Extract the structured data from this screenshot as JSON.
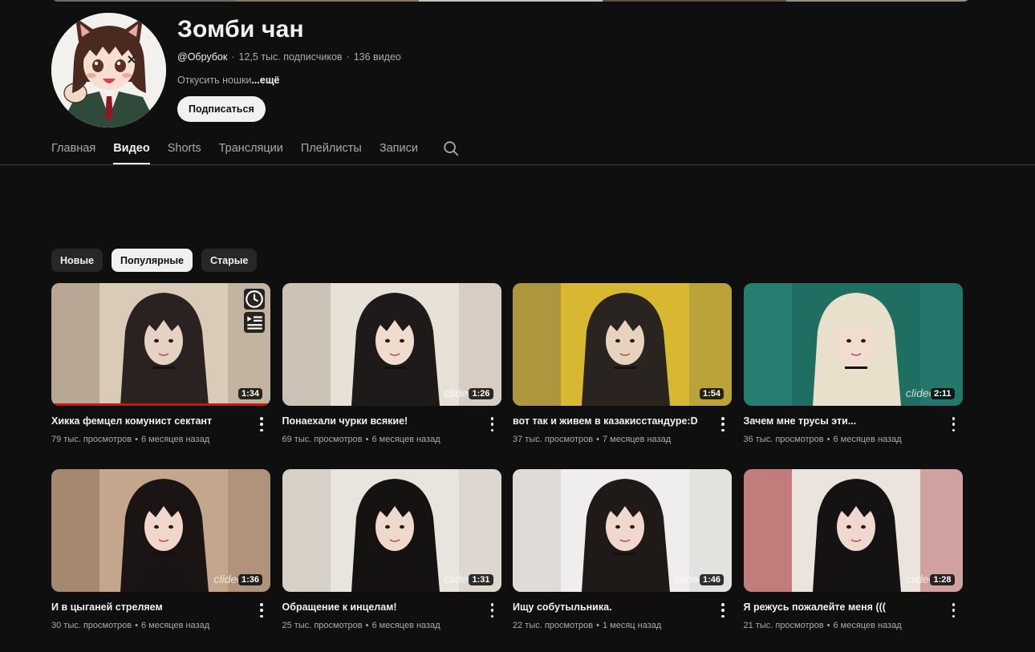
{
  "channel": {
    "name": "Зомби чан",
    "handle": "@Обрубок",
    "subscribers": "12,5 тыс. подписчиков",
    "video_count": "136 видео",
    "separator": "·",
    "description": "Откусить ношки",
    "more_label": "...ещё",
    "subscribe_label": "Подписаться"
  },
  "tabs": [
    {
      "label": "Главная",
      "active": false
    },
    {
      "label": "Видео",
      "active": true
    },
    {
      "label": "Shorts",
      "active": false
    },
    {
      "label": "Трансляции",
      "active": false
    },
    {
      "label": "Плейлисты",
      "active": false
    },
    {
      "label": "Записи",
      "active": false
    }
  ],
  "search_icon": "search-icon",
  "sort_chips": [
    {
      "label": "Новые",
      "selected": false
    },
    {
      "label": "Популярные",
      "selected": true
    },
    {
      "label": "Старые",
      "selected": false
    }
  ],
  "watermark_text": "clideo",
  "meta_separator": "•",
  "colors": {
    "background": "#0f0f0f",
    "progress": "#ff0000",
    "chip": "#272727",
    "chip_selected": "#f1f1f1"
  },
  "videos": [
    {
      "title": "Хикка фемцел комунист сектант",
      "views": "79 тыс. просмотров",
      "age": "6 месяцев назад",
      "duration": "1:34",
      "watermark": false,
      "watch_progress": 1.0,
      "hover_icons": [
        "clock-icon",
        "queue-icon"
      ],
      "palette": [
        "#d9cbb8",
        "#9c8a78",
        "#2a2220",
        "#e6d2c2"
      ]
    },
    {
      "title": "Понаехали чурки всякие!",
      "views": "69 тыс. просмотров",
      "age": "6 месяцев назад",
      "duration": "1:26",
      "watermark": true,
      "palette": [
        "#e8e1d8",
        "#b7a99a",
        "#1e1a1a",
        "#f0dccd"
      ]
    },
    {
      "title": "вот так и живем в казакисстандуре:D",
      "views": "37 тыс. просмотров",
      "age": "7 месяцев назад",
      "duration": "1:54",
      "watermark": false,
      "palette": [
        "#d8b830",
        "#8a7a4a",
        "#2a2420",
        "#e7d2c0"
      ]
    },
    {
      "title": "Зачем мне трусы эти...",
      "views": "36 тыс. просмотров",
      "age": "6 месяцев назад",
      "duration": "2:11",
      "watermark": true,
      "palette": [
        "#1e6e62",
        "#2f8a7c",
        "#e9e0cc",
        "#f2dcd0"
      ]
    },
    {
      "title": "И в цыганей стреляем",
      "views": "30 тыс. просмотров",
      "age": "6 месяцев назад",
      "duration": "1:36",
      "watermark": true,
      "palette": [
        "#c4a68c",
        "#8e6e58",
        "#1a1414",
        "#f1d6cc"
      ]
    },
    {
      "title": "Обращение к инцелам!",
      "views": "25 тыс. просмотров",
      "age": "6 месяцев назад",
      "duration": "1:31",
      "watermark": true,
      "palette": [
        "#e8e4de",
        "#c9bfb4",
        "#151212",
        "#efd8cc"
      ]
    },
    {
      "title": "Ищу собутыльника.",
      "views": "22 тыс. просмотров",
      "age": "1 месяц назад",
      "duration": "1:46",
      "watermark": true,
      "palette": [
        "#efeeec",
        "#d2ccc6",
        "#1f1a18",
        "#f0d8cc"
      ]
    },
    {
      "title": "Я режусь пожалейте меня (((",
      "views": "21 тыс. просмотров",
      "age": "6 месяцев назад",
      "duration": "1:28",
      "watermark": true,
      "palette": [
        "#eae4dc",
        "#a0262e",
        "#141212",
        "#f0d8ce"
      ]
    }
  ]
}
